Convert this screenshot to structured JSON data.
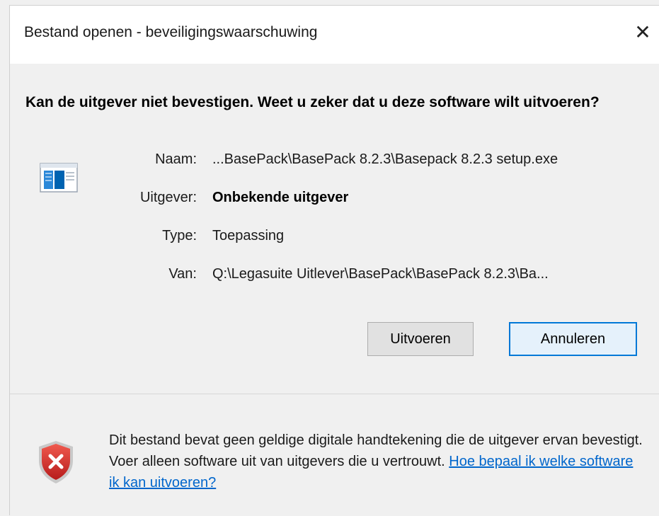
{
  "window": {
    "title": "Bestand openen - beveiligingswaarschuwing",
    "close_glyph": "✕"
  },
  "dialog": {
    "headline": "Kan de uitgever niet bevestigen. Weet u zeker dat u deze software wilt uitvoeren?",
    "fields": {
      "name_label": "Naam:",
      "name_value": "...BasePack\\BasePack 8.2.3\\Basepack 8.2.3 setup.exe",
      "publisher_label": "Uitgever:",
      "publisher_value": "Onbekende uitgever",
      "type_label": "Type:",
      "type_value": "Toepassing",
      "from_label": "Van:",
      "from_value": "Q:\\Legasuite Uitlever\\BasePack\\BasePack 8.2.3\\Ba..."
    },
    "buttons": {
      "run_label": "Uitvoeren",
      "cancel_label": "Annuleren"
    }
  },
  "footer": {
    "warning_text": "Dit bestand bevat geen geldige digitale handtekening die de uitgever ervan bevestigt. Voer alleen software uit van uitgevers die u vertrouwt. ",
    "help_link": "Hoe bepaal ik welke software ik kan uitvoeren?"
  },
  "icons": {
    "app": "application-icon",
    "shield": "security-shield-error-icon",
    "close": "close-icon"
  },
  "colors": {
    "accent": "#0078d7",
    "link": "#0066cc",
    "shield_red": "#d9302c"
  }
}
